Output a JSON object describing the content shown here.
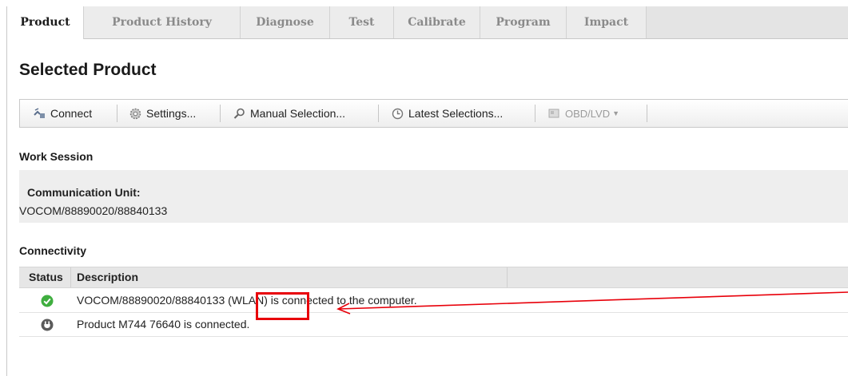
{
  "tabs": [
    {
      "label": "Product",
      "active": true
    },
    {
      "label": "Product History"
    },
    {
      "label": "Diagnose"
    },
    {
      "label": "Test"
    },
    {
      "label": "Calibrate"
    },
    {
      "label": "Program"
    },
    {
      "label": "Impact"
    }
  ],
  "page_title": "Selected Product",
  "toolbar": {
    "connect": {
      "label": "Connect",
      "icon": "connect-icon"
    },
    "settings": {
      "label": "Settings...",
      "icon": "gear-icon"
    },
    "manual_selection": {
      "label": "Manual Selection...",
      "icon": "magnifier-icon"
    },
    "latest_selections": {
      "label": "Latest Selections...",
      "icon": "clock-icon"
    },
    "obd": {
      "label": "OBD/LVD",
      "icon": "obd-icon",
      "disabled": true
    }
  },
  "work_session": {
    "heading": "Work Session",
    "label": "Communication Unit:",
    "value": "VOCOM/88890020/88840133"
  },
  "connectivity": {
    "heading": "Connectivity",
    "columns": [
      "Status",
      "Description"
    ],
    "rows": [
      {
        "status_icon": "green-check-icon",
        "description": "VOCOM/88890020/88840133 (WLAN) is connected to the computer."
      },
      {
        "status_icon": "plug-icon",
        "description": "Product M744 76640 is connected."
      }
    ]
  },
  "annotation": {
    "color": "#e8000a",
    "highlighted_text": "(WLAN)"
  }
}
